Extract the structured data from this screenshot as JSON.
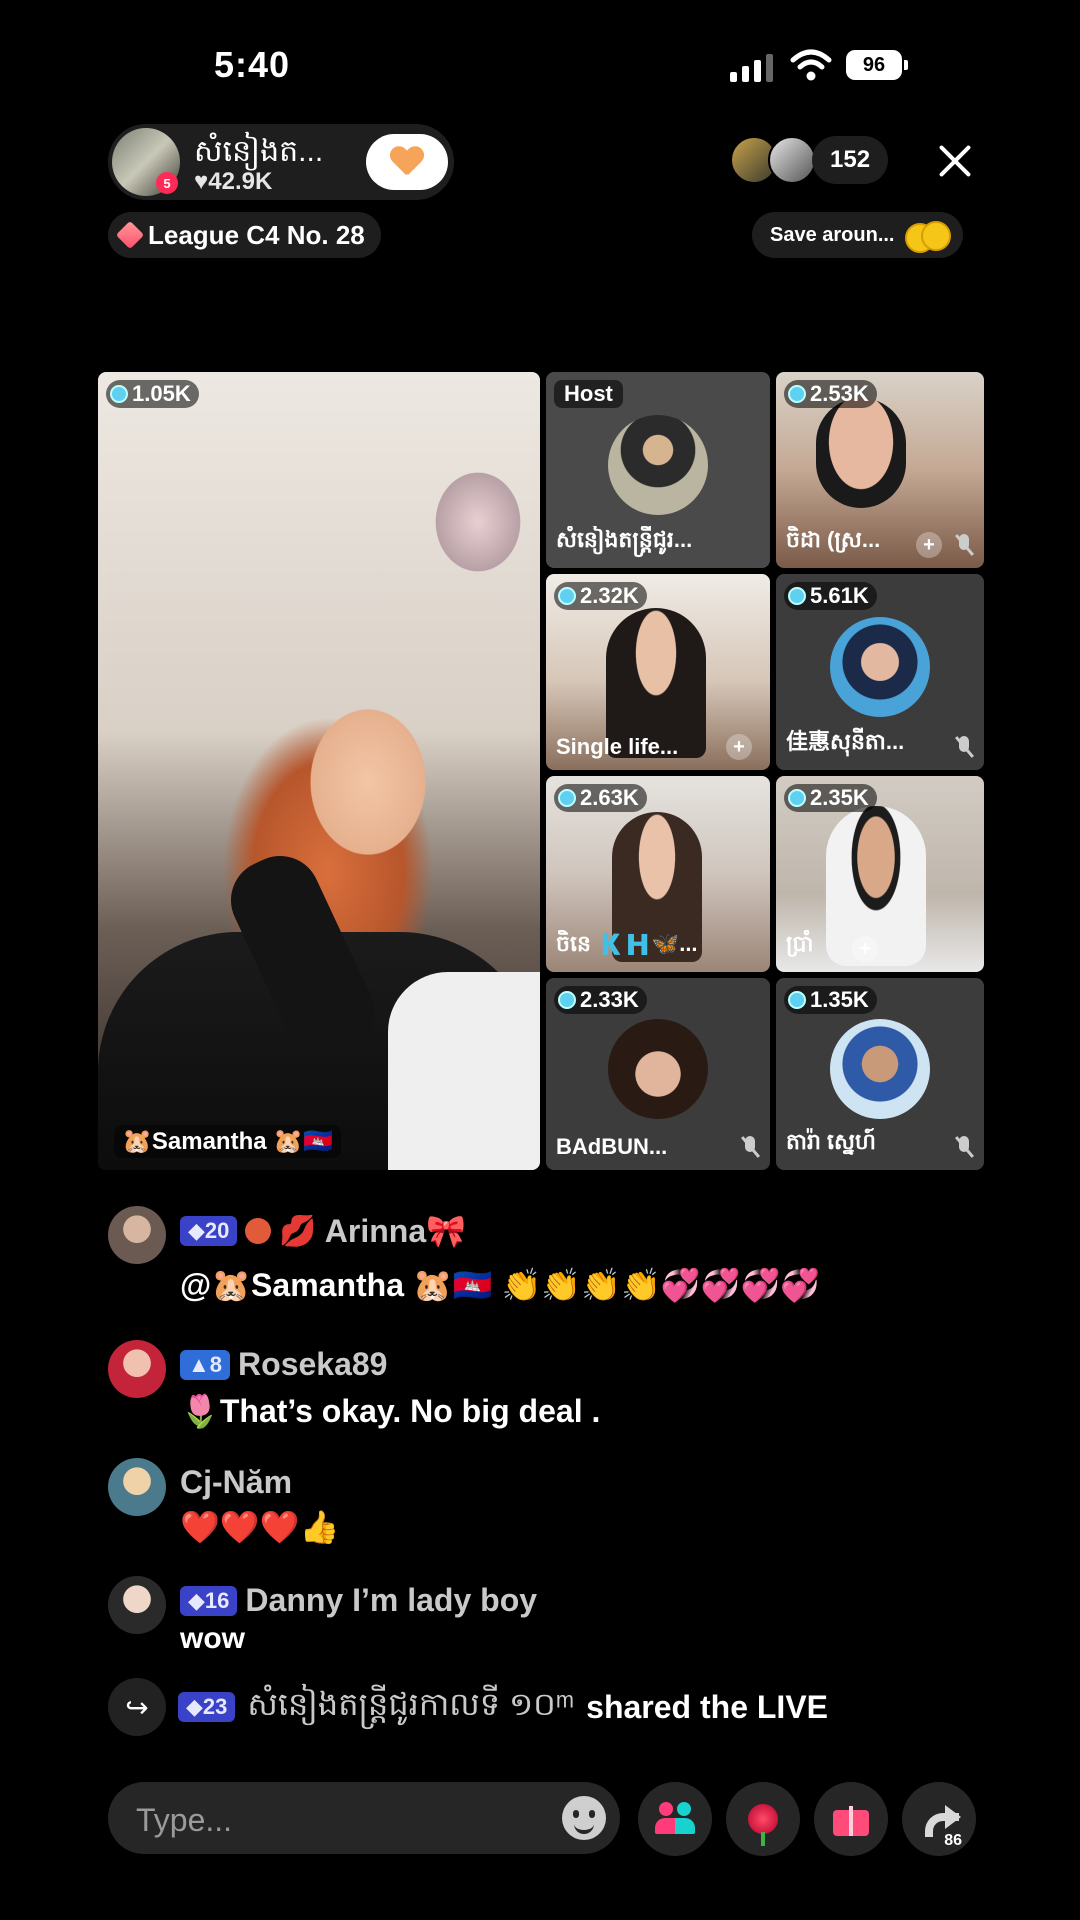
{
  "status_bar": {
    "time": "5:40",
    "battery": "96"
  },
  "header": {
    "host_name": "សំនៀងត...",
    "host_likes": "♥42.9K",
    "live_badge": "5",
    "viewer_count": "152",
    "league": "League C4 No. 28",
    "save_label": "Save aroun..."
  },
  "grid": {
    "main": {
      "count": "1.05K",
      "name": "🐹Samantha 🐹🇰🇭"
    },
    "tiles": [
      {
        "tag": "Host",
        "name": "សំនៀងតន្ត្រីជូរ..."
      },
      {
        "count": "2.53K",
        "name": "ចិដា (ស្រ..."
      },
      {
        "count": "2.32K",
        "name": "Single life..."
      },
      {
        "count": "5.61K",
        "name": "佳惠សុនីតា..."
      },
      {
        "count": "2.63K",
        "name": "ចិនេ 🇰🇭🦋..."
      },
      {
        "count": "2.35K",
        "name": "ប្រាំ"
      },
      {
        "count": "2.33K",
        "name": "BAdBUN..."
      },
      {
        "count": "1.35K",
        "name": "តារ៉ា ស្នេហ៍"
      }
    ]
  },
  "chat": [
    {
      "level": "20",
      "user": "Arinna🎀",
      "prefix": "💋",
      "text": "@🐹Samantha 🐹🇰🇭 👏👏👏👏💞💞💞💞"
    },
    {
      "level": "8",
      "user": "Roseka89",
      "text": "🌷That’s okay. No big deal ."
    },
    {
      "user": "Cj-Năm",
      "text": "❤️❤️❤️👍"
    },
    {
      "level": "16",
      "user": "Danny I’m lady boy",
      "text": "wow"
    }
  ],
  "share": {
    "level": "23",
    "user": "សំនៀងតន្ត្រីជូរកាលទី ១០ᵐ",
    "text": "shared the LIVE"
  },
  "bottom": {
    "placeholder": "Type...",
    "share_count": "86"
  }
}
